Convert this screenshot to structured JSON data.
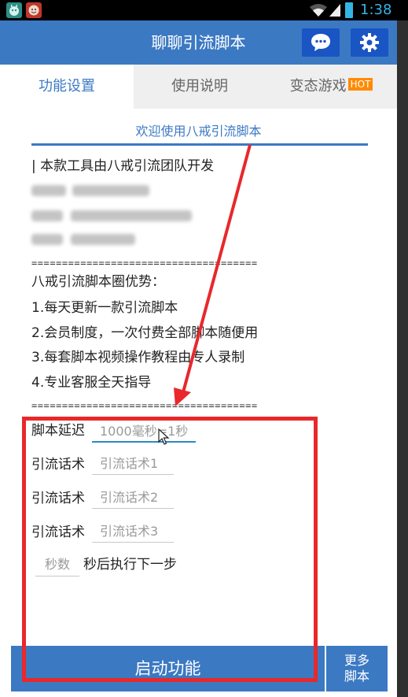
{
  "status_bar": {
    "time": "1:38",
    "app_icons": [
      "android-robot-icon",
      "red-app-icon"
    ]
  },
  "app": {
    "title": "聊聊引流脚本",
    "header_icons": [
      "chat-bubble-icon",
      "gear-icon"
    ],
    "accent_color": "#3c79c3"
  },
  "tabs": [
    {
      "label": "功能设置",
      "active": true
    },
    {
      "label": "使用说明",
      "active": false
    },
    {
      "label": "变态游戏",
      "active": false,
      "badge": "HOT"
    }
  ],
  "info": {
    "welcome": "欢迎使用八戒引流脚本",
    "credit": "| 本款工具由八戒引流团队开发",
    "divider": "=====================================",
    "perks_title": "八戒引流脚本圈优势：",
    "perks": [
      "1.每天更新一款引流脚本",
      "2.会员制度，一次付费全部脚本随便用",
      "3.每套脚本视频操作教程由专人录制",
      "4.专业客服全天指导"
    ]
  },
  "form": {
    "delay_label": "脚本延迟",
    "delay_placeholder": "1000毫秒=1秒",
    "script_label": "引流话术",
    "script_placeholders": [
      "引流话术1",
      "引流话术2",
      "引流话术3"
    ],
    "seconds_placeholder": "秒数",
    "seconds_suffix": "秒后执行下一步"
  },
  "bottom": {
    "start_label": "启动功能",
    "more_label": "更多脚本"
  },
  "annotation": {
    "highlight_color": "#e8282b"
  }
}
